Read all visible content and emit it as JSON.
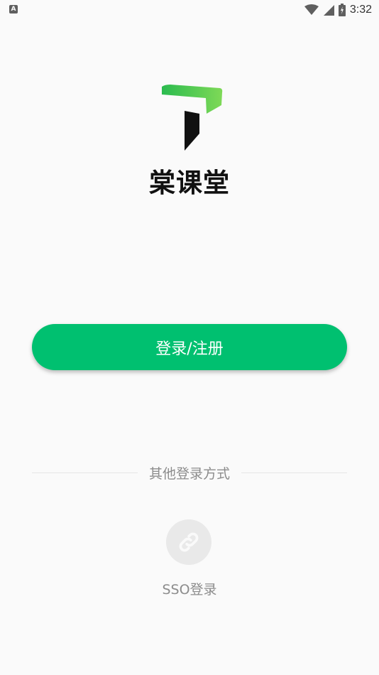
{
  "status_bar": {
    "left_icon_letter": "A",
    "time": "3:32",
    "icons": [
      "wifi-icon",
      "signal-icon",
      "battery-icon"
    ]
  },
  "brand": {
    "name": "棠课堂",
    "logo_icon": "brand-logo-icon",
    "colors": {
      "green_light": "#6fd35e",
      "green_dark": "#2bbb4f",
      "dark": "#111111"
    }
  },
  "login": {
    "button_label": "登录/注册",
    "button_color": "#00c070"
  },
  "other_login": {
    "divider_label": "其他登录方式",
    "sso": {
      "icon": "link-icon",
      "label": "SSO登录"
    }
  }
}
